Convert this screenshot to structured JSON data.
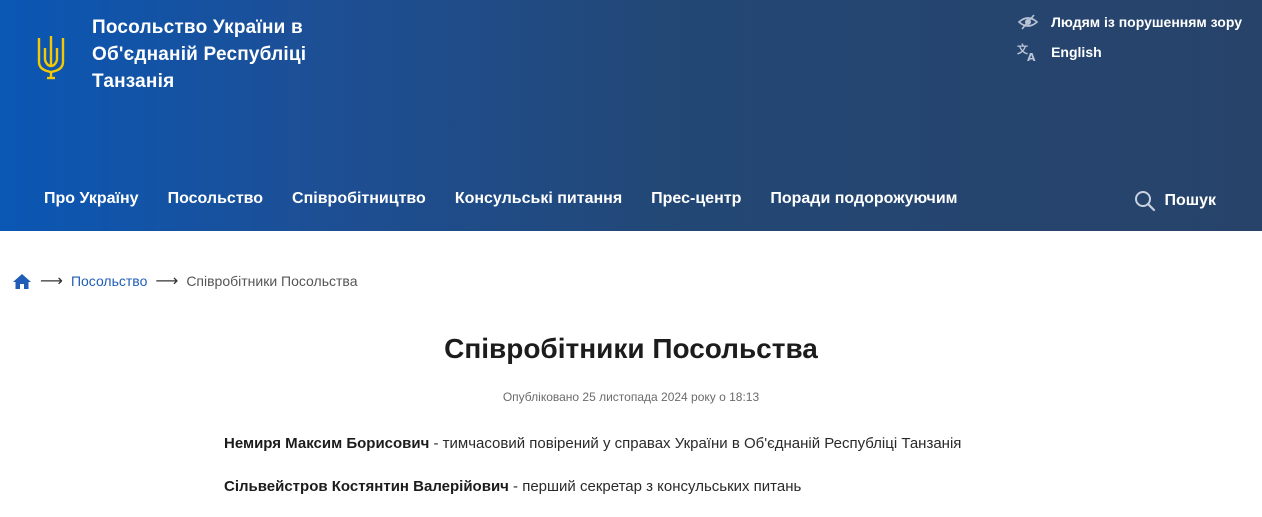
{
  "header": {
    "title": "Посольство України в Об'єднаній Республіці Танзанія",
    "accessibility_label": "Людям із порушенням зору",
    "language_label": "English",
    "accent_color": "#f5c800"
  },
  "nav": {
    "items": [
      {
        "label": "Про Україну"
      },
      {
        "label": "Посольство"
      },
      {
        "label": "Співробітництво"
      },
      {
        "label": "Консульські питання"
      },
      {
        "label": "Прес-центр"
      },
      {
        "label": "Поради подорожуючим"
      }
    ],
    "search_label": "Пошук"
  },
  "breadcrumb": {
    "home_icon": "home-icon",
    "parent": "Посольство",
    "current": "Співробітники Посольства"
  },
  "main": {
    "title": "Співробітники Посольства",
    "published": "Опубліковано 25 листопада 2024 року о 18:13",
    "staff": [
      {
        "name": "Немиря Максим Борисович",
        "role": " - тимчасовий повірений у справах України в Об'єднаній Республіці Танзанія"
      },
      {
        "name": "Сільвейстров Костянтин Валерійович",
        "role": " - перший секретар з консульських питань"
      }
    ]
  }
}
